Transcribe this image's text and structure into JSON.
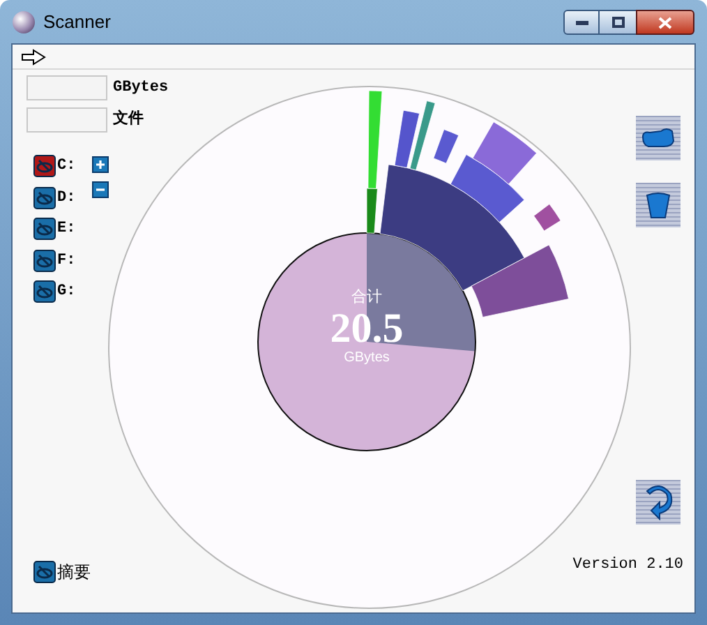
{
  "window": {
    "title": "Scanner"
  },
  "fields": [
    {
      "label": "GBytes"
    },
    {
      "label": "文件"
    }
  ],
  "drives": [
    {
      "label": "C:",
      "selected": true
    },
    {
      "label": "D:",
      "selected": false
    },
    {
      "label": "E:",
      "selected": false
    },
    {
      "label": "F:",
      "selected": false
    },
    {
      "label": "G:",
      "selected": false
    }
  ],
  "chart": {
    "caption": "合计",
    "total": "20.5",
    "unit": "GBytes"
  },
  "summary": {
    "label": "摘要"
  },
  "version": "Version 2.10"
}
